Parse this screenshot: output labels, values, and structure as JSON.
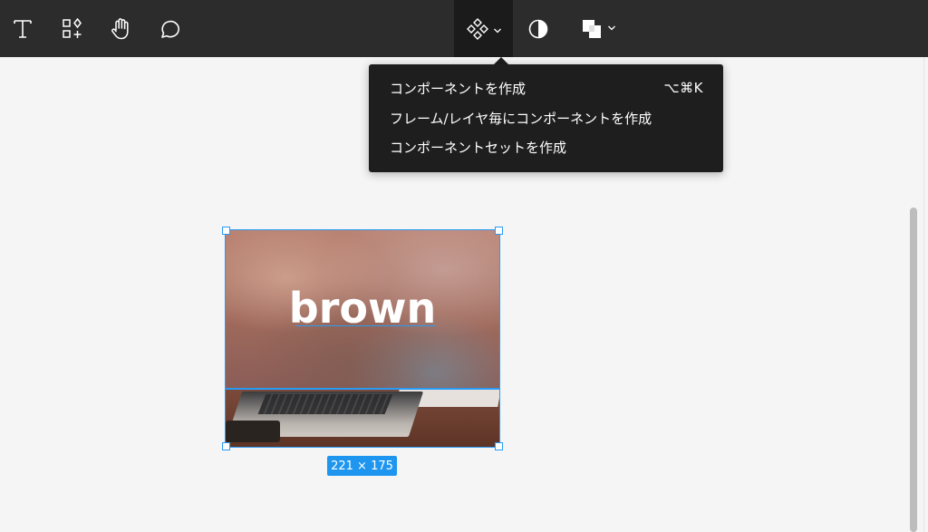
{
  "toolbar": {
    "tools": [
      {
        "name": "text-tool",
        "icon": "text-T-icon"
      },
      {
        "name": "resources-tool",
        "icon": "resources-icon"
      },
      {
        "name": "hand-tool",
        "icon": "hand-icon"
      },
      {
        "name": "comment-tool",
        "icon": "comment-bubble-icon"
      }
    ],
    "center_tools": [
      {
        "name": "component-tool",
        "icon": "component-diamonds-icon",
        "active": true
      },
      {
        "name": "mask-tool",
        "icon": "contrast-half-circle-icon"
      },
      {
        "name": "boolean-tool",
        "icon": "boolean-union-icon"
      }
    ]
  },
  "component_menu": {
    "items": [
      {
        "label": "コンポーネントを作成",
        "shortcut": "⌥⌘K"
      },
      {
        "label": "フレーム/レイヤ毎にコンポーネントを作成",
        "shortcut": ""
      },
      {
        "label": "コンポーネントセットを作成",
        "shortcut": ""
      }
    ]
  },
  "canvas": {
    "frame_text": "brown",
    "size_label": "221 × 175"
  },
  "colors": {
    "toolbar_bg": "#2c2c2c",
    "menu_bg": "#1e1e1e",
    "selection": "#2a9bf5",
    "canvas_bg": "#f5f5f5"
  }
}
